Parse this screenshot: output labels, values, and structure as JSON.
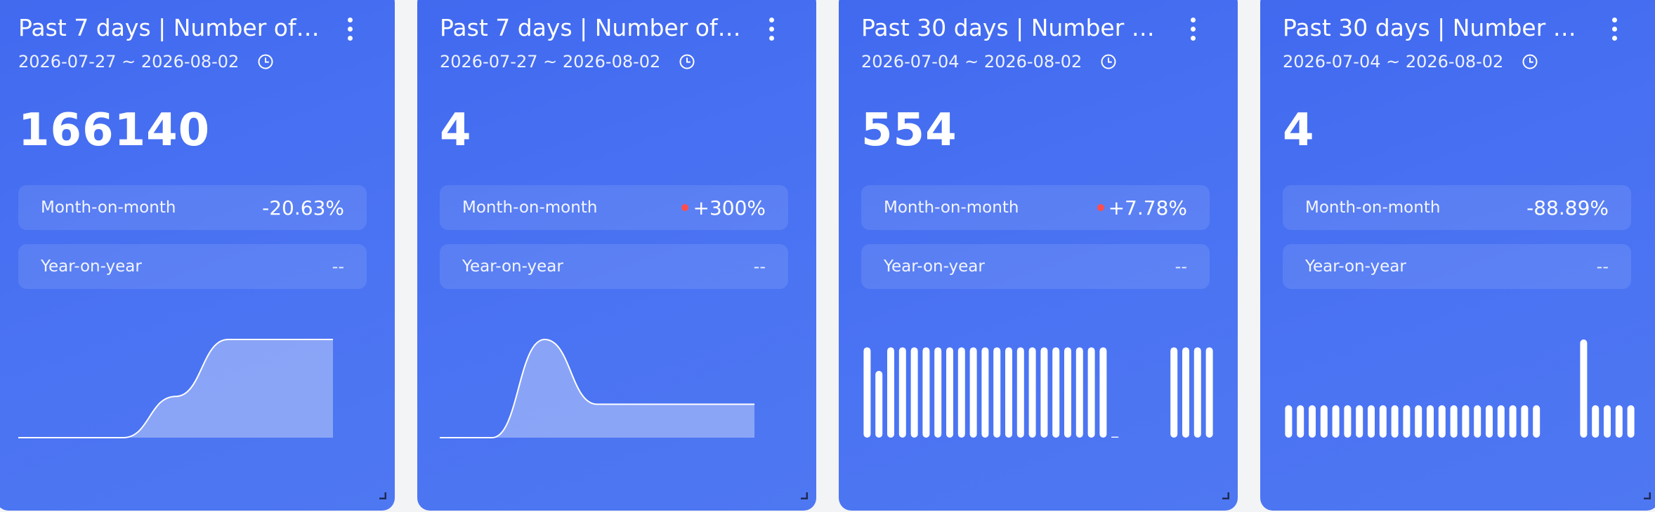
{
  "colors": {
    "card_bg": "#4a73f3",
    "text": "#ffffff",
    "increase_dot": "#ff4d4f",
    "area_fill": "rgba(255,255,255,0.35)"
  },
  "icons": {
    "menu": "more-vertical-icon",
    "date": "clock-icon",
    "corner": "resize-handle-icon"
  },
  "cards": [
    {
      "title": "Past 7 days | Number of ...",
      "date_range": "2026-07-27 ~ 2026-08-02",
      "value": "166140",
      "mom_label": "Month-on-month",
      "mom_value": "-20.63%",
      "mom_increase": false,
      "yoy_label": "Year-on-year",
      "yoy_value": "--",
      "chart_data": {
        "type": "area",
        "x": [
          1,
          2,
          3,
          4,
          5,
          6,
          7
        ],
        "values": [
          0,
          0,
          0,
          0.42,
          1,
          1,
          1
        ],
        "ylim": [
          0,
          1
        ]
      }
    },
    {
      "title": "Past 7 days | Number of ...",
      "date_range": "2026-07-27 ~ 2026-08-02",
      "value": "4",
      "mom_label": "Month-on-month",
      "mom_value": "+300%",
      "mom_increase": true,
      "yoy_label": "Year-on-year",
      "yoy_value": "--",
      "chart_data": {
        "type": "area",
        "x": [
          1,
          2,
          3,
          4,
          5,
          6,
          7
        ],
        "values": [
          0,
          0,
          1,
          0.34,
          0.34,
          0.34,
          0.34
        ],
        "ylim": [
          0,
          1
        ]
      }
    },
    {
      "title": "Past 30 days | Number of...",
      "date_range": "2026-07-04 ~ 2026-08-02",
      "value": "554",
      "mom_label": "Month-on-month",
      "mom_value": "+7.78%",
      "mom_increase": true,
      "yoy_label": "Year-on-year",
      "yoy_value": "--",
      "chart_data": {
        "type": "bar",
        "values": [
          0.92,
          0.68,
          0.92,
          0.92,
          0.92,
          0.92,
          0.92,
          0.92,
          0.92,
          0.92,
          0.92,
          0.92,
          0.92,
          0.92,
          0.92,
          0.92,
          0.92,
          0.92,
          0.92,
          0.92,
          0.92,
          0.01,
          0,
          0,
          0,
          0,
          0.92,
          0.92,
          0.92,
          0.92
        ],
        "ylim": [
          0,
          1
        ]
      }
    },
    {
      "title": "Past 30 days | Number of...",
      "date_range": "2026-07-04 ~ 2026-08-02",
      "value": "4",
      "mom_label": "Month-on-month",
      "mom_value": "-88.89%",
      "mom_increase": false,
      "yoy_label": "Year-on-year",
      "yoy_value": "--",
      "chart_data": {
        "type": "bar",
        "values": [
          0.33,
          0.33,
          0.33,
          0.33,
          0.33,
          0.33,
          0.33,
          0.33,
          0.33,
          0.33,
          0.33,
          0.33,
          0.33,
          0.33,
          0.33,
          0.33,
          0.33,
          0.33,
          0.33,
          0.33,
          0.33,
          0.33,
          0,
          0,
          0,
          1,
          0.33,
          0.33,
          0.33,
          0.33
        ],
        "ylim": [
          0,
          1
        ]
      }
    }
  ]
}
